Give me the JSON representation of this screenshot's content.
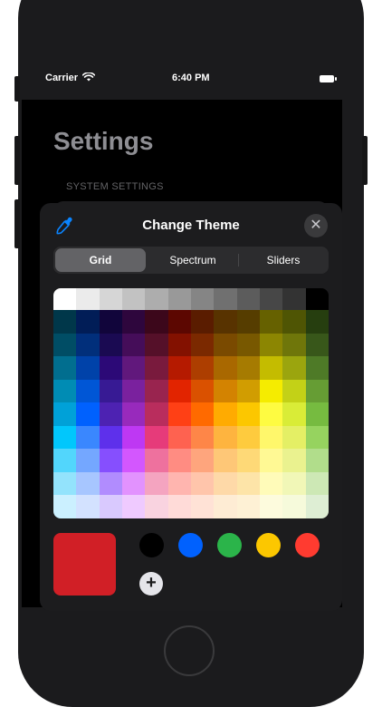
{
  "status_bar": {
    "carrier": "Carrier",
    "time": "6:40 PM"
  },
  "background": {
    "title": "Settings",
    "section_label": "SYSTEM SETTINGS"
  },
  "sheet": {
    "title": "Change Theme",
    "close_glyph": "✕",
    "tabs": [
      {
        "label": "Grid",
        "active": true
      },
      {
        "label": "Spectrum",
        "active": false
      },
      {
        "label": "Sliders",
        "active": false
      }
    ],
    "grid_rows": [
      [
        "#ffffff",
        "#ebebeb",
        "#d6d6d6",
        "#c2c2c2",
        "#adadad",
        "#999999",
        "#858585",
        "#707070",
        "#5c5c5c",
        "#474747",
        "#333333",
        "#000000"
      ],
      [
        "#00374a",
        "#011d57",
        "#11053b",
        "#2e063d",
        "#3c071b",
        "#5c0701",
        "#5a1c00",
        "#583300",
        "#563d00",
        "#666100",
        "#4f5504",
        "#263e0f"
      ],
      [
        "#004d65",
        "#012f7b",
        "#1a0a52",
        "#450d59",
        "#551029",
        "#831100",
        "#7b2900",
        "#7a4a00",
        "#785800",
        "#8c8602",
        "#6f760a",
        "#38571a"
      ],
      [
        "#016e8f",
        "#0042a9",
        "#2c0977",
        "#61187c",
        "#791a3d",
        "#b51a00",
        "#ad3e00",
        "#a96800",
        "#a67b01",
        "#c4bc00",
        "#9ba50e",
        "#4e7a27"
      ],
      [
        "#008cb4",
        "#0056d6",
        "#371a94",
        "#7a219e",
        "#99244f",
        "#e22400",
        "#da5100",
        "#d38301",
        "#d19d01",
        "#f5ec00",
        "#c3d117",
        "#669d34"
      ],
      [
        "#00a1d8",
        "#0061fe",
        "#4d22b2",
        "#982abc",
        "#b92d5d",
        "#ff4015",
        "#ff6a00",
        "#ffab01",
        "#fcc700",
        "#fefb41",
        "#d9ec37",
        "#76bb40"
      ],
      [
        "#01c7fc",
        "#3a87fe",
        "#5e30eb",
        "#be38f3",
        "#e63b7a",
        "#fe6250",
        "#fe8648",
        "#feb43f",
        "#fecb3e",
        "#fff76b",
        "#e4ef65",
        "#96d35f"
      ],
      [
        "#52d6fc",
        "#74a7ff",
        "#864ffe",
        "#d357fe",
        "#ee719e",
        "#ff8c82",
        "#fea57d",
        "#fec777",
        "#fed977",
        "#fff994",
        "#eaf28f",
        "#b1dd8b"
      ],
      [
        "#93e3fc",
        "#a7c6ff",
        "#b18cfe",
        "#e292fe",
        "#f4a4c0",
        "#ffb5af",
        "#ffc5ab",
        "#fed9a8",
        "#fde4a8",
        "#fffbb9",
        "#f1f7b7",
        "#cde8b5"
      ],
      [
        "#cbf0ff",
        "#d3e2ff",
        "#d9c9fe",
        "#efcaff",
        "#f9d3e0",
        "#ffdbd8",
        "#ffe2d6",
        "#feecd4",
        "#fef1d5",
        "#fdfbdd",
        "#f6fadb",
        "#deeed4"
      ]
    ],
    "current_color": "#d11f26",
    "swatches": [
      "#000000",
      "#0061fe",
      "#2bb44a",
      "#fcc700",
      "#ff3b30"
    ],
    "add_glyph": "+"
  },
  "icons": {
    "eyedropper": "eyedropper-icon",
    "close": "close-icon",
    "wifi": "wifi-icon",
    "battery": "battery-icon",
    "add": "plus-icon"
  },
  "colors": {
    "accent": "#0a84ff",
    "sheet_bg": "#1c1c1e",
    "segment_active": "#636366"
  }
}
